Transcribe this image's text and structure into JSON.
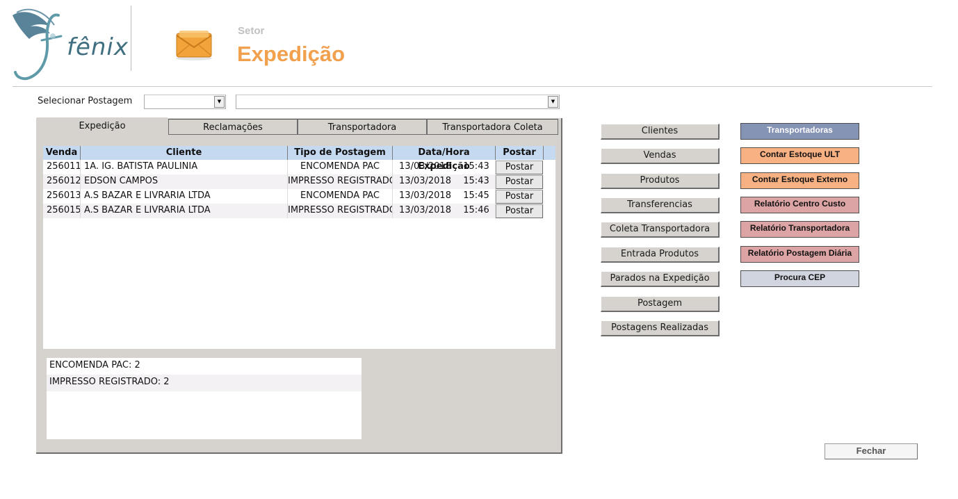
{
  "header": {
    "logo_text": "fênix",
    "sector_label": "Setor",
    "sector_title": "Expedição"
  },
  "selector": {
    "label": "Selecionar Postagem",
    "combo_a_value": "",
    "combo_b_value": ""
  },
  "tabs": [
    {
      "label": "Expedição",
      "active": true
    },
    {
      "label": "Reclamações",
      "active": false
    },
    {
      "label": "Transportadora",
      "active": false
    },
    {
      "label": "Transportadora Coleta",
      "active": false
    }
  ],
  "table": {
    "columns": [
      "Venda",
      "Cliente",
      "Tipo de Postagem",
      "Data/Hora Expedição",
      "Postar"
    ],
    "rows": [
      {
        "venda": "256011",
        "cliente": "1A. IG. BATISTA PAULINIA",
        "tipo": "ENCOMENDA PAC",
        "data": "13/03/2018",
        "hora": "15:43",
        "action": "Postar"
      },
      {
        "venda": "256012",
        "cliente": "EDSON CAMPOS",
        "tipo": "IMPRESSO REGISTRADO",
        "data": "13/03/2018",
        "hora": "15:43",
        "action": "Postar"
      },
      {
        "venda": "256013",
        "cliente": "A.S BAZAR E LIVRARIA LTDA",
        "tipo": "ENCOMENDA PAC",
        "data": "13/03/2018",
        "hora": "15:45",
        "action": "Postar"
      },
      {
        "venda": "256015",
        "cliente": "A.S BAZAR E LIVRARIA LTDA",
        "tipo": "IMPRESSO REGISTRADO",
        "data": "13/03/2018",
        "hora": "15:46",
        "action": "Postar"
      }
    ]
  },
  "summary": [
    "ENCOMENDA PAC: 2",
    "IMPRESSO REGISTRADO: 2"
  ],
  "nav_buttons": [
    "Clientes",
    "Vendas",
    "Produtos",
    "Transferencias",
    "Coleta Transportadora",
    "Entrada Produtos",
    "Parados na Expedição",
    "Postagem",
    "Postagens Realizadas"
  ],
  "report_buttons": [
    {
      "label": "Transportadoras",
      "color": "#8593b5",
      "text_color": "#ffffff"
    },
    {
      "label": "Contar Estoque ULT",
      "color": "#f8b183",
      "text_color": "#111111"
    },
    {
      "label": "Contar Estoque Externo",
      "color": "#f8b183",
      "text_color": "#111111"
    },
    {
      "label": "Relatório Centro Custo",
      "color": "#dca4a4",
      "text_color": "#111111"
    },
    {
      "label": "Relatório Transportadora",
      "color": "#dca4a4",
      "text_color": "#111111"
    },
    {
      "label": "Relatório Postagem Diária",
      "color": "#dca4a4",
      "text_color": "#111111"
    },
    {
      "label": "Procura CEP",
      "color": "#d0d5df",
      "text_color": "#111111"
    }
  ],
  "close_button": "Fechar"
}
